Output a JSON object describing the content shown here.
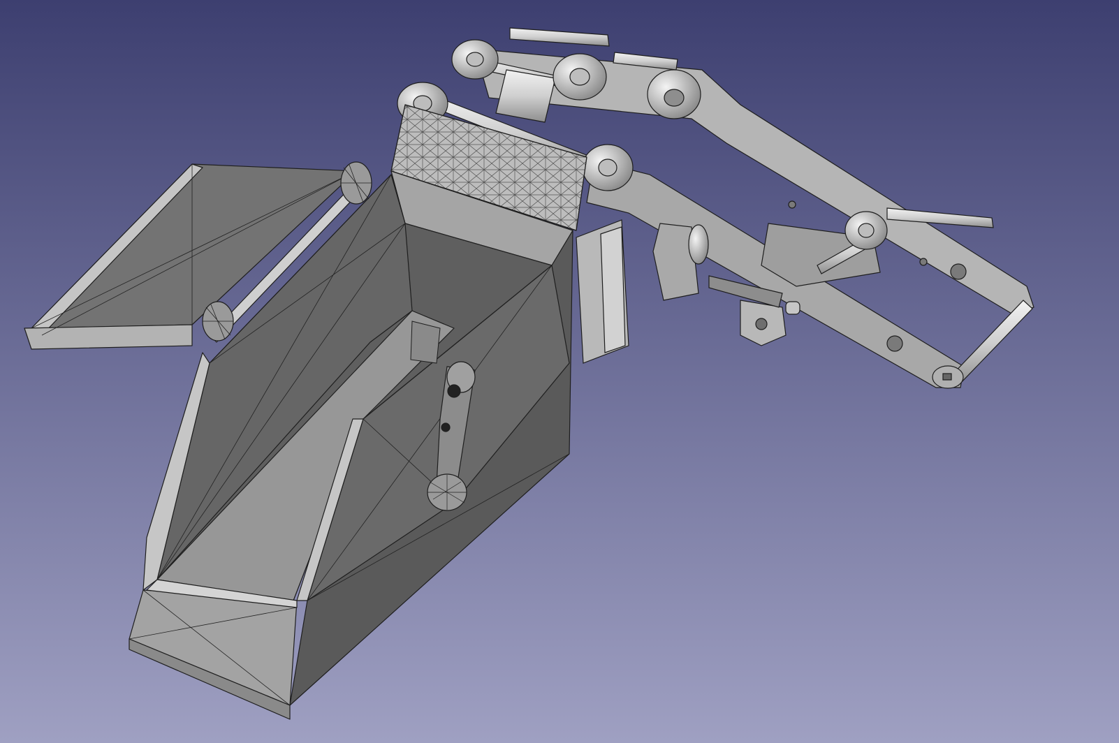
{
  "viewport": {
    "background_top": "#3d3f70",
    "background_bottom": "#9fa0c2"
  },
  "model": {
    "shade_light": "#c4c4c4",
    "shade_mid": "#9a9a9a",
    "shade_dark": "#5c5c5c",
    "edge": "#1e1e1e"
  }
}
